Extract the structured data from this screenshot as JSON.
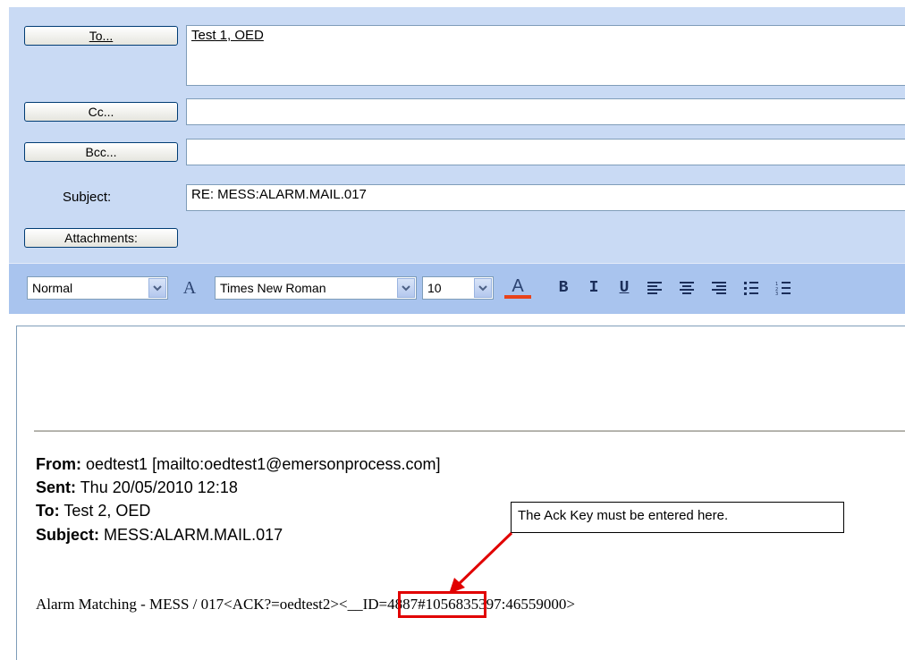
{
  "header": {
    "to_button": "To...",
    "to_value": "Test 1, OED",
    "cc_button": "Cc...",
    "cc_value": "",
    "bcc_button": "Bcc...",
    "bcc_value": "",
    "subject_label": "Subject:",
    "subject_value": "RE: MESS:ALARM.MAIL.017",
    "attachments_button": "Attachments:"
  },
  "toolbar": {
    "style": "Normal",
    "font": "Times New Roman",
    "size": "10",
    "font_color": "#e8421a",
    "icons": [
      "font-size-icon",
      "font-color-icon",
      "bold-icon",
      "italic-icon",
      "underline-icon",
      "align-left-icon",
      "align-center-icon",
      "align-right-icon",
      "bullets-icon",
      "numbering-icon"
    ]
  },
  "message": {
    "from_label": "From:",
    "from_value": "oedtest1 [mailto:oedtest1@emersonprocess.com]",
    "sent_label": "Sent:",
    "sent_value": "Thu 20/05/2010 12:18",
    "to_label": "To:",
    "to_value": "Test 2, OED",
    "subject_label": "Subject:",
    "subject_value": "MESS:ALARM.MAIL.017",
    "body_before": "Alarm Matching - MESS / 017<ACK?=",
    "ack_key": "oedtest2",
    "body_after": "><__ID=4887#1056835397:46559000>"
  },
  "annotation": {
    "callout_text": "The Ack Key must be entered here.",
    "highlight_color": "#e10000"
  }
}
